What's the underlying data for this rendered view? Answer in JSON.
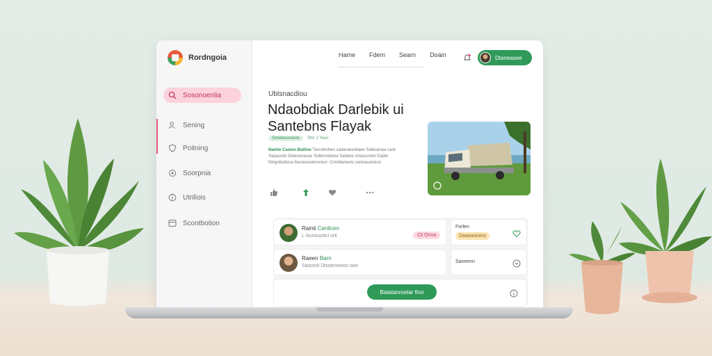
{
  "app": {
    "name": "Rordngoia"
  },
  "sidebar": {
    "items": [
      {
        "label": "Sosonoenlia",
        "icon": "search-icon",
        "active": true
      },
      {
        "label": "Sening",
        "icon": "users-icon"
      },
      {
        "label": "Poitning",
        "icon": "shield-icon"
      },
      {
        "label": "Soorpnia",
        "icon": "target-icon"
      },
      {
        "label": "Utriliois",
        "icon": "info-icon"
      },
      {
        "label": "Scontbotion",
        "icon": "layout-icon"
      }
    ]
  },
  "topnav": {
    "links": [
      "Hame",
      "Fdem",
      "Searn",
      "Doain"
    ],
    "profile_name": "Dtaneasee"
  },
  "hero": {
    "kicker": "Ubtsnacdiou",
    "headline_line1": "Ndaobdiak Darlebik ui",
    "headline_line2": "Santebns Flayak",
    "tag": "Sonetasoracos",
    "tag_meta": "Sttn 1 Yevo",
    "desc_lead": "Nantie Casion Batline",
    "desc_rest": "Tiesolonhen sadanarenbaen Sabeainoe carb Sapasoiin Delerasouoa: Soblnnotiana Sadane cinasisrreei Dojbe Ningnbulisisa ifacoesesioronoor: Cnnidianeoiu sooinauoneso",
    "action_icons": [
      "thumbs-up-icon",
      "arrow-up-icon",
      "heart-icon",
      "more-icon"
    ]
  },
  "rows": [
    {
      "name_lead": "Rainti",
      "name_accent": "Cenlicen",
      "sub": "L /ocnouoticl orti",
      "pill": "Cli Onna"
    },
    {
      "name_lead": "Raeen",
      "name_accent": "Barn",
      "sub": "Sasosnt Dtsseroriooo ooo"
    }
  ],
  "side_cards": [
    {
      "title": "Forlen",
      "pill": "Daaeaoinino"
    },
    {
      "title": "Saneenn"
    }
  ],
  "cta": {
    "label": "Batatanroelar finn"
  },
  "colors": {
    "accent_green": "#2f9a58",
    "accent_pink": "#e2577a"
  }
}
